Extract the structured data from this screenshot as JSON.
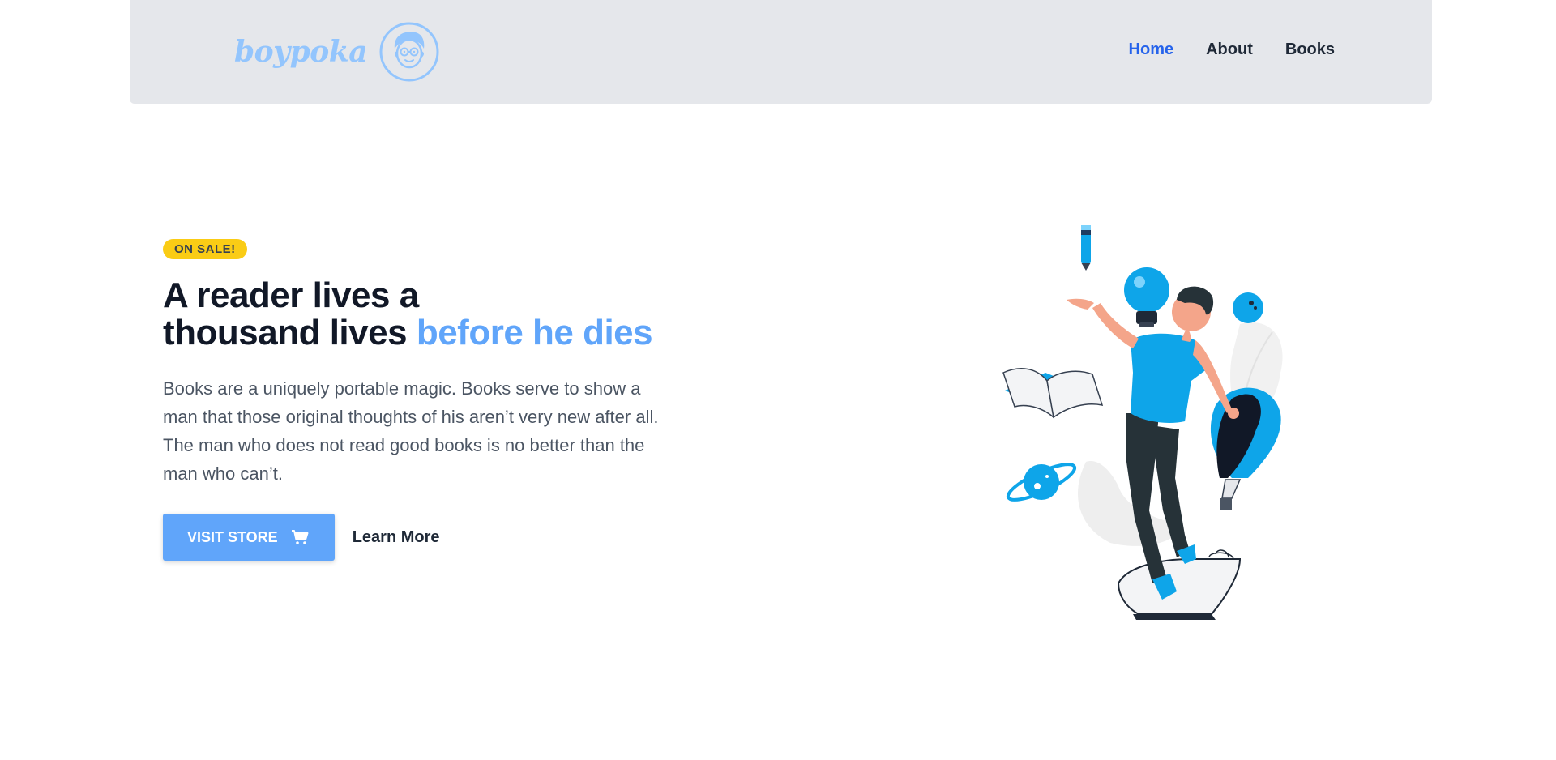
{
  "header": {
    "brand_name": "boypoka",
    "nav": [
      {
        "label": "Home",
        "active": true
      },
      {
        "label": "About",
        "active": false
      },
      {
        "label": "Books",
        "active": false
      }
    ]
  },
  "hero": {
    "badge": "ON SALE!",
    "headline_part1": "A reader lives a",
    "headline_part2": "thousand lives",
    "headline_accent": "before he dies",
    "description": "Books are a uniquely portable magic. Books serve to show a man that those original thoughts of his aren’t very new after all. The man who does not read good books is no better than the man who can’t.",
    "primary_button": "VISIT STORE",
    "secondary_button": "Learn More"
  },
  "icons": {
    "logo": "boy-face-icon",
    "cart": "cart-icon"
  },
  "colors": {
    "accent": "#60a5fa",
    "nav_active": "#2563eb",
    "badge": "#facc15",
    "header_bg": "#e5e7eb",
    "illustration_blue": "#0ea5e9"
  }
}
